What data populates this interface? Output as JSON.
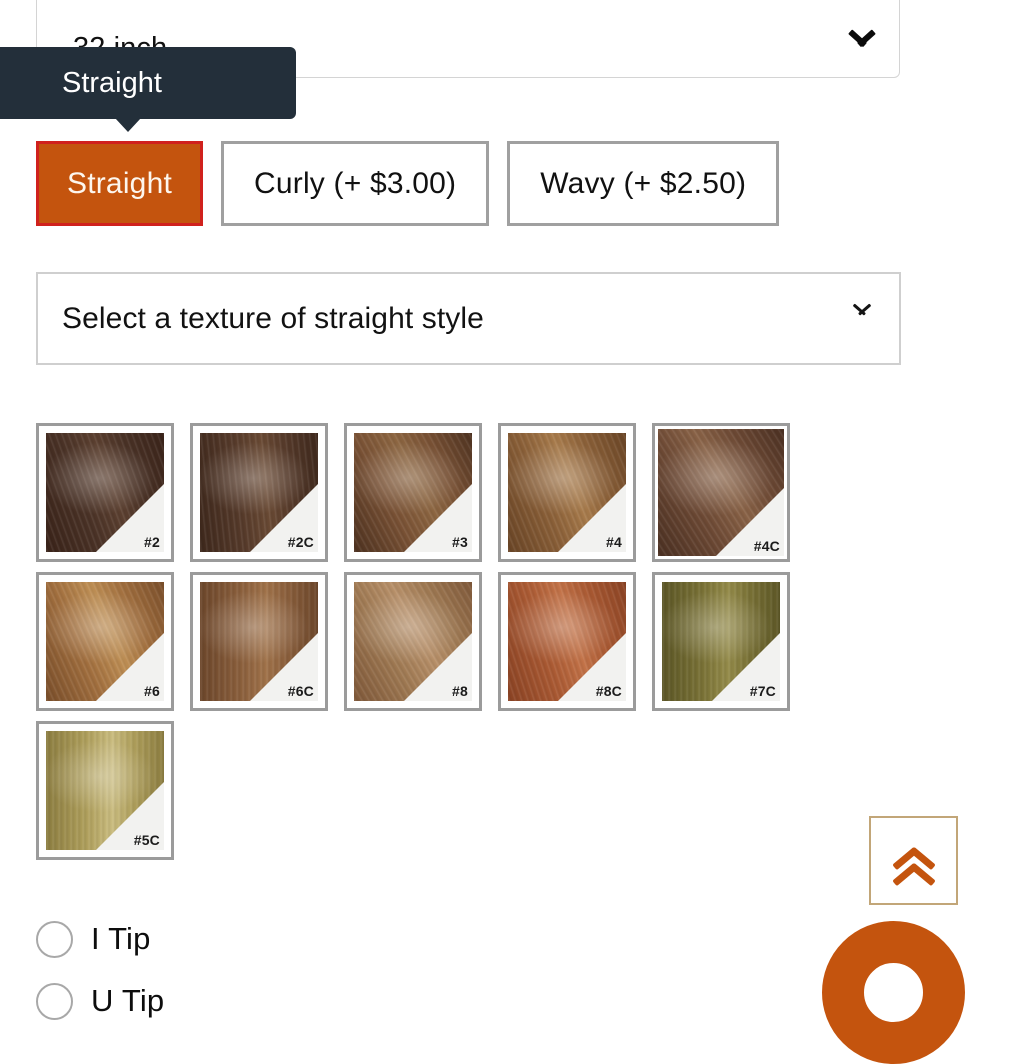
{
  "size_select": {
    "name": "length-select",
    "value": "32 inch",
    "icon": "chevron-down-icon"
  },
  "tooltip": {
    "text": "Straight"
  },
  "style_options": [
    {
      "label": "Straight",
      "selected": true
    },
    {
      "label": "Curly  (+ $3.00)",
      "selected": false
    },
    {
      "label": "Wavy  (+ $2.50)",
      "selected": false
    }
  ],
  "texture_select": {
    "value": "Select a texture of straight style",
    "icon": "chevron-down-icon"
  },
  "swatches": [
    {
      "label": "#2",
      "c1": "#4a3226",
      "c2": "#3a2319",
      "c3": "#5c4030",
      "ang": "70deg",
      "tight": false
    },
    {
      "label": "#2C",
      "c1": "#563a2a",
      "c2": "#3e281c",
      "c3": "#6a4a34",
      "ang": "84deg",
      "tight": false
    },
    {
      "label": "#3",
      "c1": "#7a5235",
      "c2": "#4e3220",
      "c3": "#8e6742",
      "ang": "62deg",
      "tight": false
    },
    {
      "label": "#4",
      "c1": "#8b6038",
      "c2": "#6a4526",
      "c3": "#a97c4c",
      "ang": "68deg",
      "tight": false
    },
    {
      "label": "#4C",
      "c1": "#6e4a35",
      "c2": "#4b3022",
      "c3": "#8a6347",
      "ang": "58deg",
      "tight": true
    },
    {
      "label": "#6",
      "c1": "#a3703f",
      "c2": "#7b4f2b",
      "c3": "#c09055",
      "ang": "66deg",
      "tight": false
    },
    {
      "label": "#6C",
      "c1": "#8b5f3c",
      "c2": "#6d472b",
      "c3": "#a1734a",
      "ang": "90deg",
      "tight": false
    },
    {
      "label": "#8",
      "c1": "#a07a53",
      "c2": "#80593a",
      "c3": "#b9916a",
      "ang": "60deg",
      "tight": false
    },
    {
      "label": "#8C",
      "c1": "#ab5a33",
      "c2": "#8b4324",
      "c3": "#c47348",
      "ang": "72deg",
      "tight": false
    },
    {
      "label": "#7C",
      "c1": "#7a7236",
      "c2": "#5d5726",
      "c3": "#958c4a",
      "ang": "90deg",
      "tight": false
    },
    {
      "label": "#5C",
      "c1": "#b0a05c",
      "c2": "#8d7e41",
      "c3": "#cbbd80",
      "ang": "90deg",
      "tight": false
    }
  ],
  "tip_options": [
    {
      "label": "I Tip",
      "selected": false
    },
    {
      "label": "U Tip",
      "selected": false
    }
  ],
  "back_to_top": {
    "icon": "double-chevron-up-icon"
  },
  "colors": {
    "accent_orange": "#c4540e",
    "selected_border_red": "#d0211d",
    "tooltip_bg": "#232f3a",
    "swatch_border": "#9b9b9b",
    "back_to_top_border": "#c2a678"
  }
}
